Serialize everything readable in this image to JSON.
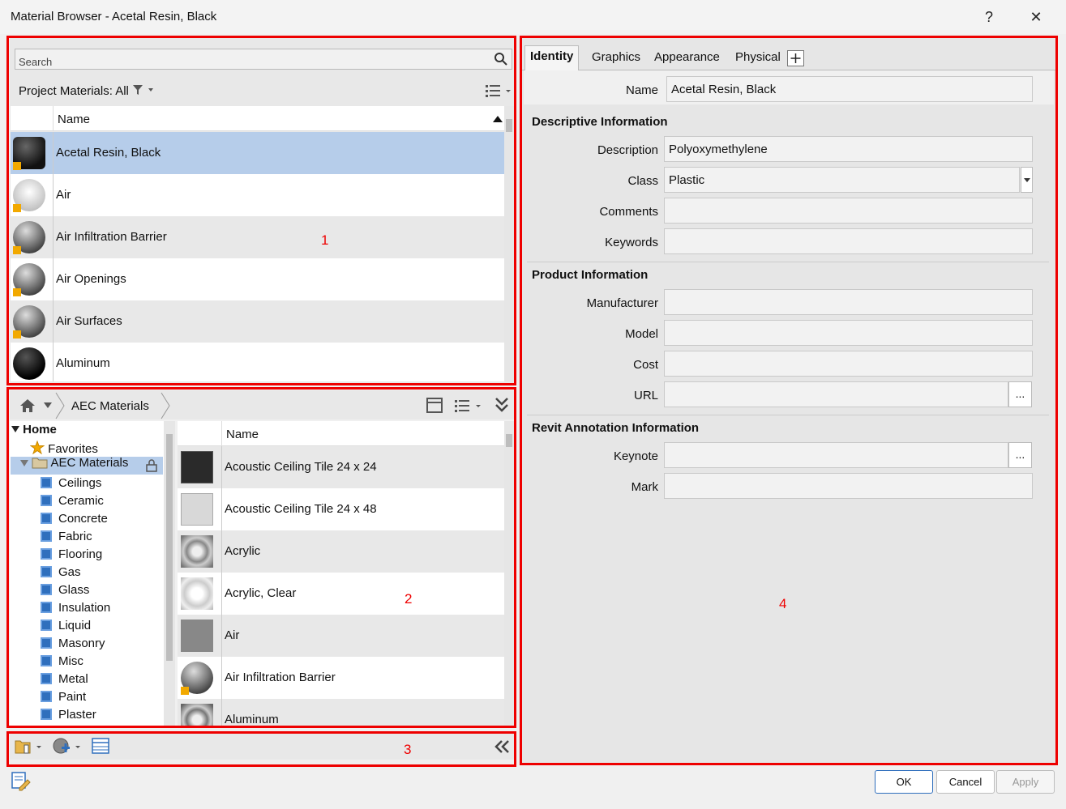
{
  "window": {
    "title": "Material Browser - Acetal Resin, Black",
    "help": "?",
    "close": "✕"
  },
  "search": {
    "placeholder": "Search"
  },
  "project": {
    "filter_label": "Project Materials: All",
    "column_name": "Name",
    "rows": [
      "Acetal Resin, Black",
      "Air",
      "Air Infiltration Barrier",
      "Air Openings",
      "Air Surfaces",
      "Aluminum"
    ]
  },
  "library": {
    "breadcrumb": "AEC Materials",
    "tree": {
      "home": "Home",
      "favorites": "Favorites",
      "aec": "AEC Materials",
      "children": [
        "Ceilings",
        "Ceramic",
        "Concrete",
        "Fabric",
        "Flooring",
        "Gas",
        "Glass",
        "Insulation",
        "Liquid",
        "Masonry",
        "Misc",
        "Metal",
        "Paint",
        "Plaster"
      ]
    },
    "column_name": "Name",
    "rows": [
      "Acoustic Ceiling Tile 24 x 24",
      "Acoustic Ceiling Tile 24 x 48",
      "Acrylic",
      "Acrylic, Clear",
      "Air",
      "Air Infiltration Barrier",
      "Aluminum"
    ]
  },
  "tabs": [
    "Identity",
    "Graphics",
    "Appearance",
    "Physical"
  ],
  "identity": {
    "name_label": "Name",
    "name_value": "Acetal Resin, Black",
    "descriptive_header": "Descriptive Information",
    "description_label": "Description",
    "description_value": "Polyoxymethylene",
    "class_label": "Class",
    "class_value": "Plastic",
    "comments_label": "Comments",
    "keywords_label": "Keywords",
    "product_header": "Product Information",
    "manufacturer_label": "Manufacturer",
    "model_label": "Model",
    "cost_label": "Cost",
    "url_label": "URL",
    "revit_header": "Revit Annotation Information",
    "keynote_label": "Keynote",
    "mark_label": "Mark",
    "dots": "..."
  },
  "buttons": {
    "ok": "OK",
    "cancel": "Cancel",
    "apply": "Apply"
  },
  "annotations": [
    "1",
    "2",
    "3",
    "4"
  ],
  "colors": {
    "highlight": "#b6cdea",
    "annotation": "#e00000",
    "folder_icon": "#2f6fbd"
  }
}
